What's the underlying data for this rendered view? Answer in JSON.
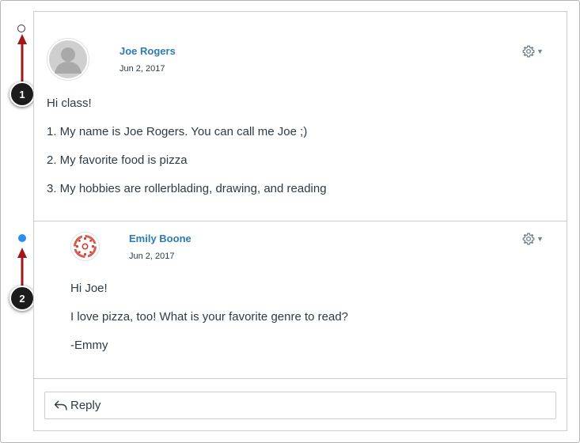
{
  "posts": [
    {
      "author": "Joe Rogers",
      "date": "Jun 2, 2017",
      "avatar_icon": "default-user-avatar-icon",
      "lines": [
        "Hi class!",
        "1. My name is Joe Rogers. You can call me Joe ;)",
        "2. My favorite food is pizza",
        "3. My hobbies are rollerblading, drawing, and reading"
      ]
    },
    {
      "author": "Emily Boone",
      "date": "Jun 2, 2017",
      "avatar_icon": "canvas-logo-avatar-icon",
      "lines": [
        "Hi Joe!",
        "I love pizza, too! What is your favorite genre to read?",
        "-Emmy"
      ]
    }
  ],
  "reply": {
    "label": "Reply",
    "icon": "reply-arrow-icon"
  },
  "callouts": [
    "1",
    "2"
  ],
  "colors": {
    "link": "#2d7bb6",
    "text": "#2d3b45",
    "unread_dot": "#2c8ef0",
    "callout_arrow": "#a01818",
    "border": "#c7cdd1"
  }
}
